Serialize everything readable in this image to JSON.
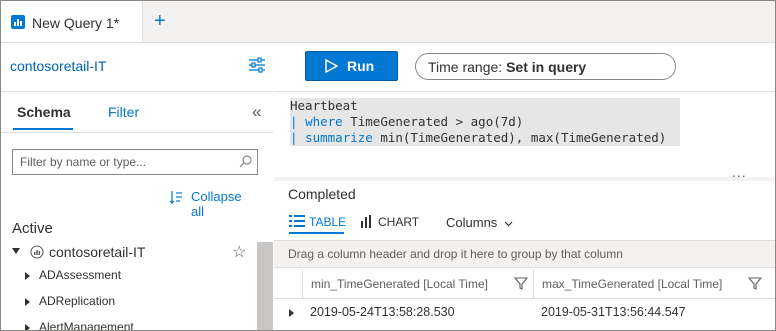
{
  "tabs": {
    "active_label": "New Query 1*",
    "add_label": "+"
  },
  "toolbar": {
    "workspace": "contosoretail-IT",
    "run_label": "Run",
    "time_range_prefix": "Time range: ",
    "time_range_value": "Set in query"
  },
  "left_panel": {
    "tab_schema": "Schema",
    "tab_filter": "Filter",
    "collapse_icon": "«",
    "filter_placeholder": "Filter by name or type...",
    "collapse_all": "Collapse all",
    "active_header": "Active",
    "workspace_node": "contosoretail-IT",
    "star": "☆",
    "items": [
      "ADAssessment",
      "ADReplication",
      "AlertManagement"
    ]
  },
  "editor": {
    "line1": "Heartbeat",
    "line2_pipe": "| ",
    "line2_kw": "where",
    "line2_rest": " TimeGenerated > ago(7d)",
    "line3_pipe": "| ",
    "line3_kw": "summarize",
    "line3_rest": " min(TimeGenerated), max(TimeGenerated)",
    "more": "..."
  },
  "results": {
    "status": "Completed",
    "view_table": "TABLE",
    "view_chart": "CHART",
    "columns_label": "Columns",
    "group_hint": "Drag a column header and drop it here to group by that column",
    "columns": [
      "min_TimeGenerated [Local Time]",
      "max_TimeGenerated [Local Time]"
    ],
    "rows": [
      [
        "2019-05-24T13:58:28.530",
        "2019-05-31T13:56:44.547"
      ]
    ]
  },
  "colors": {
    "accent": "#0078d4",
    "run_button": "#0078d4",
    "panel_bg": "#f3f2f1"
  }
}
